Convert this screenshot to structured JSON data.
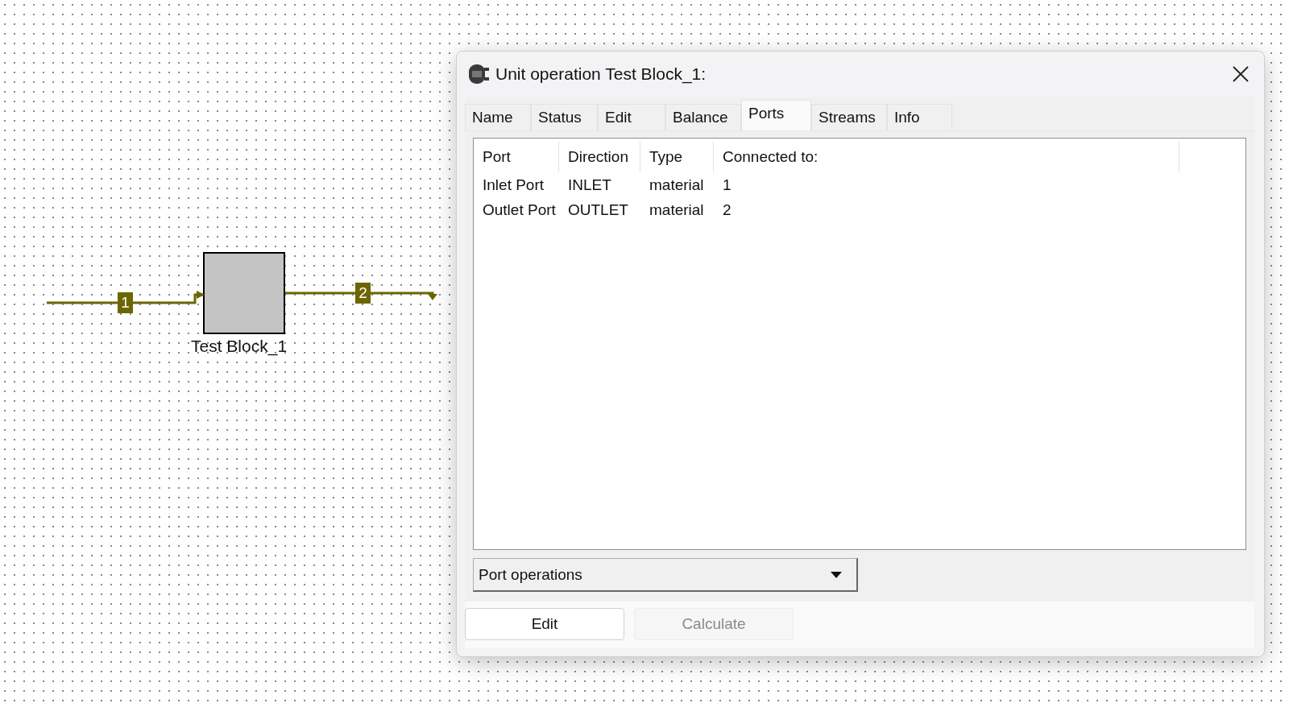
{
  "canvas": {
    "block": {
      "label": "Test Block_1"
    },
    "streams": [
      {
        "kind": "inlet",
        "label": "1"
      },
      {
        "kind": "outlet",
        "label": "2"
      }
    ]
  },
  "window": {
    "title": "Unit operation Test Block_1:"
  },
  "tabs": [
    {
      "label": "Name",
      "selected": false
    },
    {
      "label": "Status",
      "selected": false
    },
    {
      "label": "Edit",
      "selected": false
    },
    {
      "label": "Balance",
      "selected": false
    },
    {
      "label": "Ports",
      "selected": true
    },
    {
      "label": "Streams",
      "selected": false
    },
    {
      "label": "Info",
      "selected": false
    }
  ],
  "table": {
    "columns": [
      "Port",
      "Direction",
      "Type",
      "Connected to:"
    ],
    "rows": [
      [
        "Inlet Port",
        "INLET",
        "material",
        "1"
      ],
      [
        "Outlet Port",
        "OUTLET",
        "material",
        "2"
      ]
    ]
  },
  "dropdown": {
    "value": "Port operations"
  },
  "buttons": [
    {
      "label": "Edit",
      "disabled": false
    },
    {
      "label": "Calculate",
      "disabled": true
    }
  ]
}
